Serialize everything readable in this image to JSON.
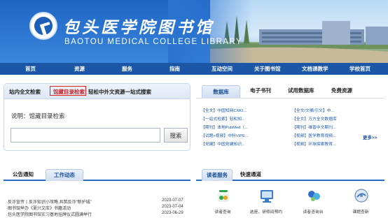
{
  "header": {
    "title_cn": "包头医学院图书馆",
    "title_en": "BAOTOU MEDICAL COLLEGE LIBRARY"
  },
  "nav": {
    "items": [
      {
        "label": "首页"
      },
      {
        "label": "资源"
      },
      {
        "label": "服务"
      },
      {
        "label": "指南"
      },
      {
        "label": "互动空间"
      },
      {
        "label": "关于图书馆"
      },
      {
        "label": "文档课教学"
      },
      {
        "label": "学校首页"
      }
    ]
  },
  "search": {
    "tabs": [
      {
        "label": "站内全文检索"
      },
      {
        "label": "馆藏目录检索"
      },
      {
        "label": "轻松中外文资源一站式搜索"
      }
    ],
    "active_tab": "馆藏目录检索",
    "description": "说明：馆藏目录检索",
    "input_value": "",
    "button_label": "搜索"
  },
  "databases": {
    "tabs": [
      {
        "label": "数据库"
      },
      {
        "label": "电子书刊"
      },
      {
        "label": "试用数据库"
      },
      {
        "label": "免费资源"
      }
    ],
    "left_links": [
      "·【全文】中国知网CNKI...",
      "·【一站式检索】轻松知...",
      "·【期刊】本地PubMed（...",
      "·【试题+视频】中科VIPE...",
      "·【党建】中国党建知识..."
    ],
    "right_links": [
      "·【全文/文摘/引文】中...",
      "·【全文】万方全文数据库",
      "·【期刊】维普中文期刊...",
      "·【视频】医学教育视频...",
      "·【视频】环球探索教育..."
    ],
    "more_label": "更多>>"
  },
  "notices": {
    "tabs": [
      {
        "label": "公告通知"
      },
      {
        "label": "工作动态"
      }
    ],
    "items": [
      {
        "title": "·反诈宣传丨反诈知识小攻略 共筑反诈“新护城”",
        "date": "2023-07-07"
      },
      {
        "title": "·图书馆举办《夏兴文库》书籍活动",
        "date": "2023-07-04"
      },
      {
        "title": "·包头医学院图书馆实习基地挂牌仪式圆满举行",
        "date": "2023-06-29"
      }
    ]
  },
  "services": {
    "tabs": [
      {
        "label": "读者服务"
      },
      {
        "label": "快速通道"
      }
    ],
    "items": [
      {
        "label": "读者查询",
        "icon": "reader-query-icon",
        "color": "#2aa84a"
      },
      {
        "label": "选座、研修间预约",
        "icon": "seat-booking-icon",
        "color": "#3d7cc9"
      },
      {
        "label": "读者咨询台",
        "icon": "consult-desk-icon",
        "color": "#2f6fc7"
      },
      {
        "label": "课题查新",
        "icon": "novelty-search-icon",
        "color": "#6b8fb3"
      }
    ]
  },
  "colors": {
    "nav_bg": "#1b56a7",
    "link": "#1b56a7",
    "highlight_border": "#e02020"
  }
}
